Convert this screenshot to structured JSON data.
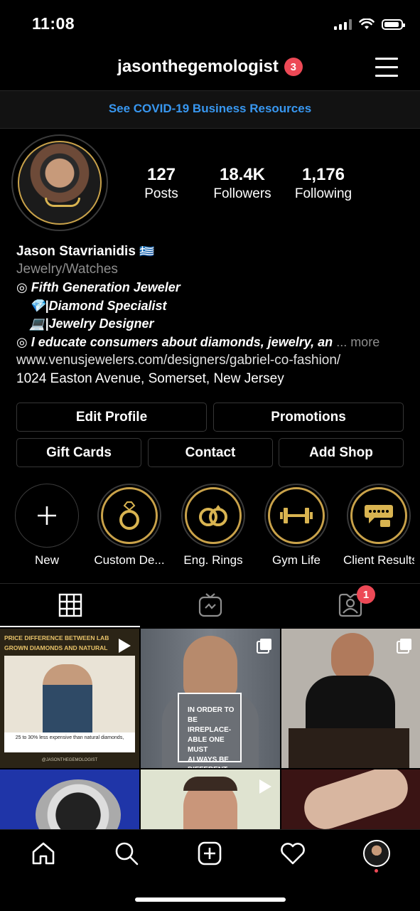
{
  "status_bar": {
    "time": "11:08"
  },
  "header": {
    "username": "jasonthegemologist",
    "notification_count": "3",
    "covid_link": "See COVID-19 Business Resources"
  },
  "stats": [
    {
      "value": "127",
      "label": "Posts"
    },
    {
      "value": "18.4K",
      "label": "Followers"
    },
    {
      "value": "1,176",
      "label": "Following"
    }
  ],
  "bio": {
    "name": "Jason Stavrianidis",
    "flag": "🇬🇷",
    "category": "Jewelry/Watches",
    "line1": "◎ Fifth Generation Jeweler",
    "line2": "💎|Diamond Specialist",
    "line3": "💻|Jewelry Designer",
    "line4": "◎ I educate consumers about diamonds, jewelry, an",
    "more": "... more",
    "link": "www.venusjewelers.com/designers/gabriel-co-fashion/",
    "address": "1024 Easton Avenue, Somerset, New Jersey"
  },
  "buttons": {
    "edit_profile": "Edit Profile",
    "promotions": "Promotions",
    "gift_cards": "Gift Cards",
    "contact": "Contact",
    "add_shop": "Add Shop"
  },
  "highlights": [
    {
      "label": "New",
      "icon": "plus-icon"
    },
    {
      "label": "Custom De...",
      "icon": "ring-icon"
    },
    {
      "label": "Eng. Rings",
      "icon": "rings-icon"
    },
    {
      "label": "Gym Life",
      "icon": "dumbbell-icon"
    },
    {
      "label": "Client Results",
      "icon": "review-icon"
    }
  ],
  "tabs": {
    "active": "grid",
    "tagged_badge": "1"
  },
  "posts": {
    "p1_title": "PRICE DIFFERENCE BETWEEN LAB GROWN DIAMONDS AND NATURAL DIAMONDS",
    "p1_caption": "25 to 30% less expensive than natural diamonds,",
    "p1_footer": "@JASONTHEGEMOLOGIST",
    "p2_quote": "IN ORDER TO BE IRREPLACE-ABLE ONE MUST ALWAYS BE DIFFERENT."
  },
  "colors": {
    "accent_blue": "#3897f0",
    "badge_red": "#ed4956",
    "gold": "#c9a24a"
  }
}
